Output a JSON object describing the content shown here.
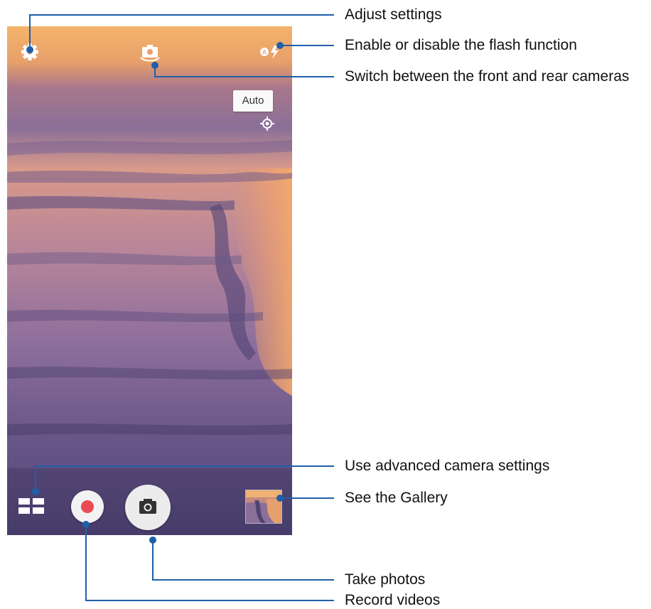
{
  "camera_ui": {
    "focus_mode_label": "Auto",
    "colors": {
      "shutter_bg": "#ececec",
      "record_dot": "#e94b52",
      "callout_line": "#1f5fa8"
    },
    "icons": {
      "settings": "gear-icon",
      "switch_camera": "camera-switch-icon",
      "flash": "flash-auto-icon",
      "focus": "focus-target-icon",
      "modes": "grid-icon",
      "record": "record-icon",
      "shutter": "camera-icon",
      "gallery": "gallery-thumbnail"
    }
  },
  "callouts": [
    "Adjust settings",
    "Enable or disable the flash function",
    "Switch between the front and rear cameras",
    "Use advanced camera settings",
    "See the Gallery",
    "Take photos",
    "Record videos"
  ]
}
